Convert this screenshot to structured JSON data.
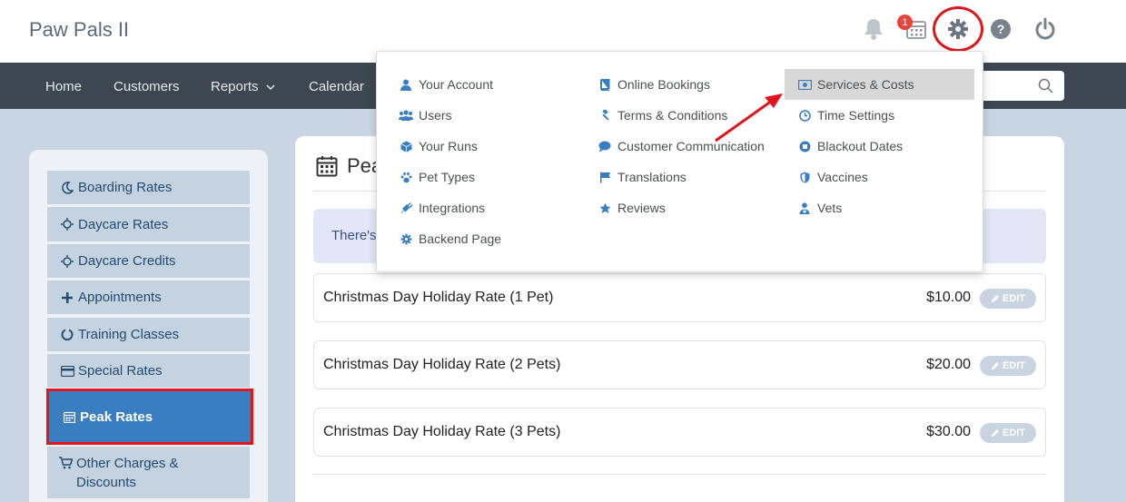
{
  "header": {
    "brand": "Paw Pals II",
    "badge_count": "1"
  },
  "nav": {
    "items": [
      {
        "label": "Home"
      },
      {
        "label": "Customers"
      },
      {
        "label": "Reports"
      },
      {
        "label": "Calendar"
      }
    ]
  },
  "dropdown": {
    "col1": [
      {
        "label": "Your Account",
        "icon": "user-icon"
      },
      {
        "label": "Users",
        "icon": "users-icon"
      },
      {
        "label": "Your Runs",
        "icon": "cube-icon"
      },
      {
        "label": "Pet Types",
        "icon": "paw-icon"
      },
      {
        "label": "Integrations",
        "icon": "plug-icon"
      },
      {
        "label": "Backend Page",
        "icon": "cog-icon"
      }
    ],
    "col2": [
      {
        "label": "Online Bookings",
        "icon": "book-icon"
      },
      {
        "label": "Terms & Conditions",
        "icon": "gavel-icon"
      },
      {
        "label": "Customer Communication",
        "icon": "comment-icon"
      },
      {
        "label": "Translations",
        "icon": "flag-icon"
      },
      {
        "label": "Reviews",
        "icon": "star-icon"
      }
    ],
    "col3": [
      {
        "label": "Services & Costs",
        "icon": "money-icon"
      },
      {
        "label": "Time Settings",
        "icon": "clock-icon"
      },
      {
        "label": "Blackout Dates",
        "icon": "stop-icon"
      },
      {
        "label": "Vaccines",
        "icon": "shield-icon"
      },
      {
        "label": "Vets",
        "icon": "doctor-icon"
      }
    ]
  },
  "sidebar": {
    "items": [
      {
        "label": "Boarding Rates",
        "icon": "moon-icon"
      },
      {
        "label": "Daycare Rates",
        "icon": "sun-icon"
      },
      {
        "label": "Daycare Credits",
        "icon": "sun-icon"
      },
      {
        "label": "Appointments",
        "icon": "plus-icon"
      },
      {
        "label": "Training Classes",
        "icon": "circle-notch-icon"
      },
      {
        "label": "Special Rates",
        "icon": "credit-card-icon"
      },
      {
        "label": "Peak Rates",
        "icon": "calendar-icon"
      },
      {
        "label": "Other Charges & Discounts",
        "icon": "cart-icon"
      }
    ]
  },
  "main": {
    "title": "Pea",
    "notice": "There's",
    "edit_label": "EDIT",
    "rates": [
      {
        "name": "Christmas Day Holiday Rate (1 Pet)",
        "price": "$10.00"
      },
      {
        "name": "Christmas Day Holiday Rate (2 Pets)",
        "price": "$20.00"
      },
      {
        "name": "Christmas Day Holiday Rate (3 Pets)",
        "price": "$30.00"
      }
    ]
  },
  "colors": {
    "accent_blue": "#3a7ec2",
    "highlight_red": "#e0161b",
    "nav_dark": "#3e4651"
  }
}
